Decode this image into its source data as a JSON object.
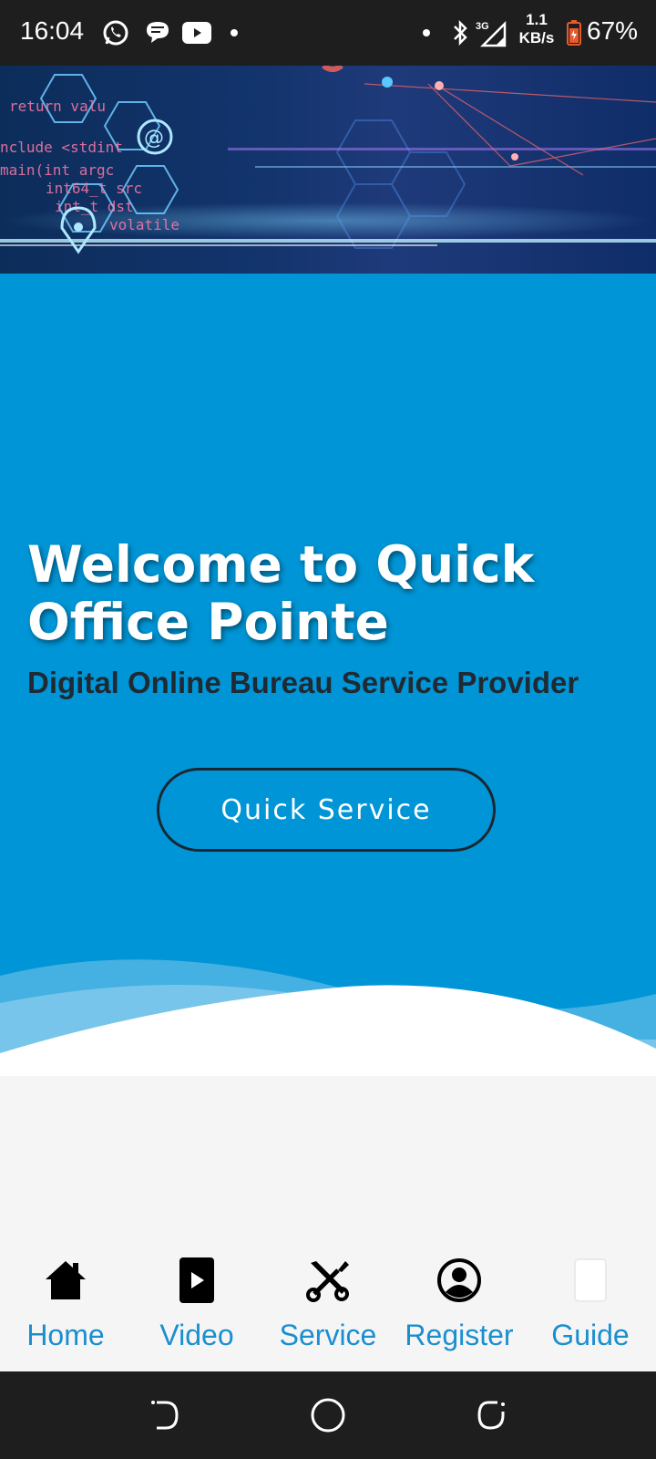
{
  "status_bar": {
    "time": "16:04",
    "speed_value": "1.1",
    "speed_unit": "KB/s",
    "battery": "67%",
    "network": "3G",
    "icons": [
      "whatsapp-icon",
      "messages-icon",
      "youtube-icon",
      "bluetooth-icon",
      "signal-icon",
      "battery-icon"
    ]
  },
  "banner": {
    "title": "Welcome to Quick Office Pointe",
    "subtitle": "Digital Online Bureau Service Provider",
    "button_label": "Quick Service",
    "background_color": "#0095d6"
  },
  "bottom_nav": {
    "items": [
      {
        "label": "Home",
        "icon": "home-icon"
      },
      {
        "label": "Video",
        "icon": "video-icon"
      },
      {
        "label": "Service",
        "icon": "tools-icon"
      },
      {
        "label": "Register",
        "icon": "account-circle-icon"
      },
      {
        "label": "Guide",
        "icon": "guide-icon"
      }
    ],
    "label_color": "#1a8fd0"
  },
  "system_nav": {
    "buttons": [
      "back-icon",
      "home-circle-icon",
      "recents-icon"
    ]
  }
}
